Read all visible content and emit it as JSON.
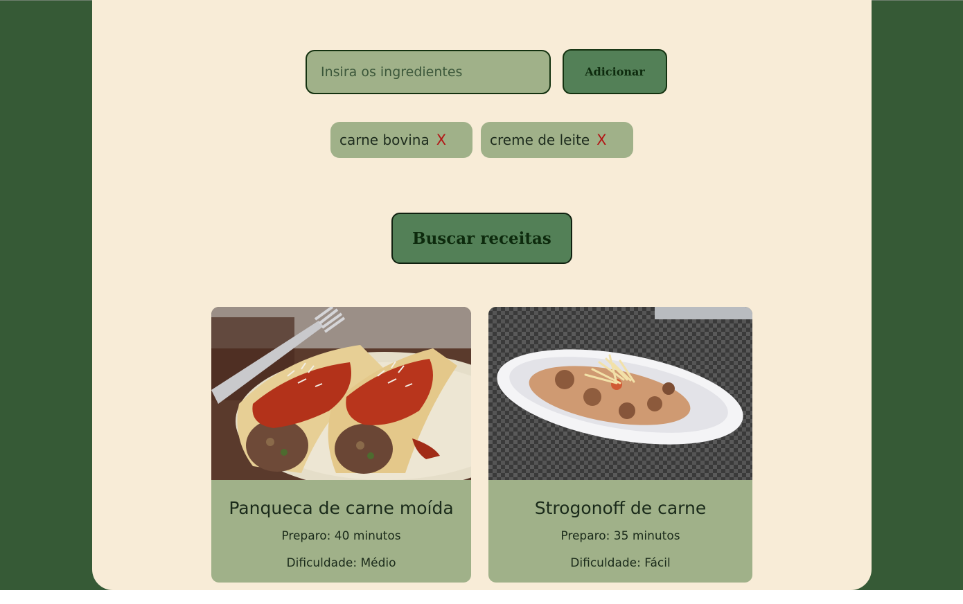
{
  "form": {
    "input_placeholder": "Insira os ingredientes",
    "add_label": "Adicionar",
    "search_label": "Buscar receitas"
  },
  "ingredients": [
    {
      "label": "carne bovina",
      "remove": "X"
    },
    {
      "label": "creme de leite",
      "remove": "X"
    }
  ],
  "recipes": [
    {
      "title": "Panqueca de carne moída",
      "prep": "Preparo: 40 minutos",
      "difficulty": "Dificuldade: Médio"
    },
    {
      "title": "Strogonoff de carne",
      "prep": "Preparo: 35 minutos",
      "difficulty": "Dificuldade: Fácil"
    }
  ],
  "colors": {
    "background": "#365a36",
    "panel": "#f8ecd7",
    "sage": "#a0b189",
    "button": "#538057",
    "remove": "#b21616"
  }
}
